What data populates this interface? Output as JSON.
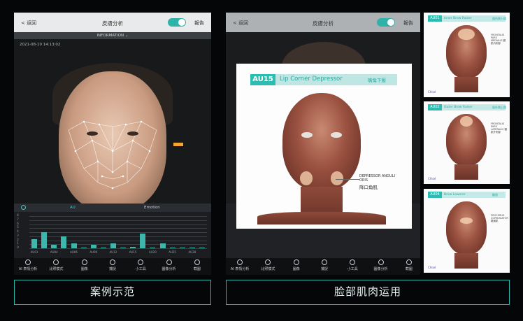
{
  "panel1": {
    "back_label": "< 返回",
    "title": "皮膚分析",
    "report_label": "報告",
    "info_bar": "INFORMATION ⌄",
    "datetime": "2021-08-10 14:13:02",
    "chart_header_left": "AU",
    "chart_header_right": "Emotion",
    "y_ticks": [
      "8",
      "7",
      "6",
      "5",
      "4",
      "3",
      "2",
      "1",
      "0"
    ],
    "tools": [
      {
        "icon": "ai-face-icon",
        "label": "AI 表情分析"
      },
      {
        "icon": "compare-icon",
        "label": "比照模式"
      },
      {
        "icon": "image-icon",
        "label": "圖像"
      },
      {
        "icon": "capture-icon",
        "label": "捕捉"
      },
      {
        "icon": "tools-icon",
        "label": "小工具"
      },
      {
        "icon": "face-analysis-icon",
        "label": "圖像分析"
      },
      {
        "icon": "screenshot-icon",
        "label": "截圖"
      }
    ]
  },
  "panel2": {
    "back_label": "< 返回",
    "title": "皮膚分析",
    "report_label": "報告",
    "tools": [
      "AI 表情分析",
      "比照模式",
      "圖像",
      "捕捉",
      "小工具",
      "圖像分析",
      "截圖"
    ]
  },
  "popup": {
    "code": "AU15",
    "name": "Lip Corner Depressor",
    "name_cn": "嘴角下壓",
    "muscle_label": "DEPRESSOR ANGULI ORIS",
    "muscle_label_cn": "降口角肌"
  },
  "thumbs": [
    {
      "code": "AU01",
      "name": "Inner Brow Raiser",
      "name_cn": "眉內側上揚",
      "note": "FRONTALIS PARS MEDIALIS 額肌內側部",
      "logo": "Chloé"
    },
    {
      "code": "AU02",
      "name": "Outer Brow Raiser",
      "name_cn": "眉外側上揚",
      "note": "FRONTALIS PARS LATERALIS 額肌外側部",
      "logo": "Chloé"
    },
    {
      "code": "AU04",
      "name": "Brow Lowerer",
      "name_cn": "皺眉",
      "note": "PROCERUS CORRUGATOR 皺眉肌",
      "logo": "Chloé"
    }
  ],
  "captions": {
    "left": "案例示范",
    "right": "脸部肌肉运用"
  },
  "chart_data": {
    "type": "bar",
    "categories": [
      "AU01",
      "AU02",
      "AU04",
      "AU05",
      "AU06",
      "AU07",
      "AU09",
      "AU10",
      "AU12",
      "AU14",
      "AU15",
      "AU17",
      "AU20",
      "AU23",
      "AU25",
      "AU26",
      "AU28",
      "AU45"
    ],
    "values": [
      2.2,
      4.0,
      0.8,
      3.0,
      1.3,
      0.2,
      0.8,
      0.1,
      1.2,
      0.1,
      0.3,
      3.6,
      0.1,
      1.2,
      0.1,
      0.1,
      0.1,
      0.1
    ],
    "ylim": [
      0,
      8
    ],
    "xlabel": "",
    "ylabel": "",
    "color": "#3fb6ab"
  },
  "colors": {
    "accent": "#2bb8ac",
    "warning_tag": "#f2a533"
  }
}
